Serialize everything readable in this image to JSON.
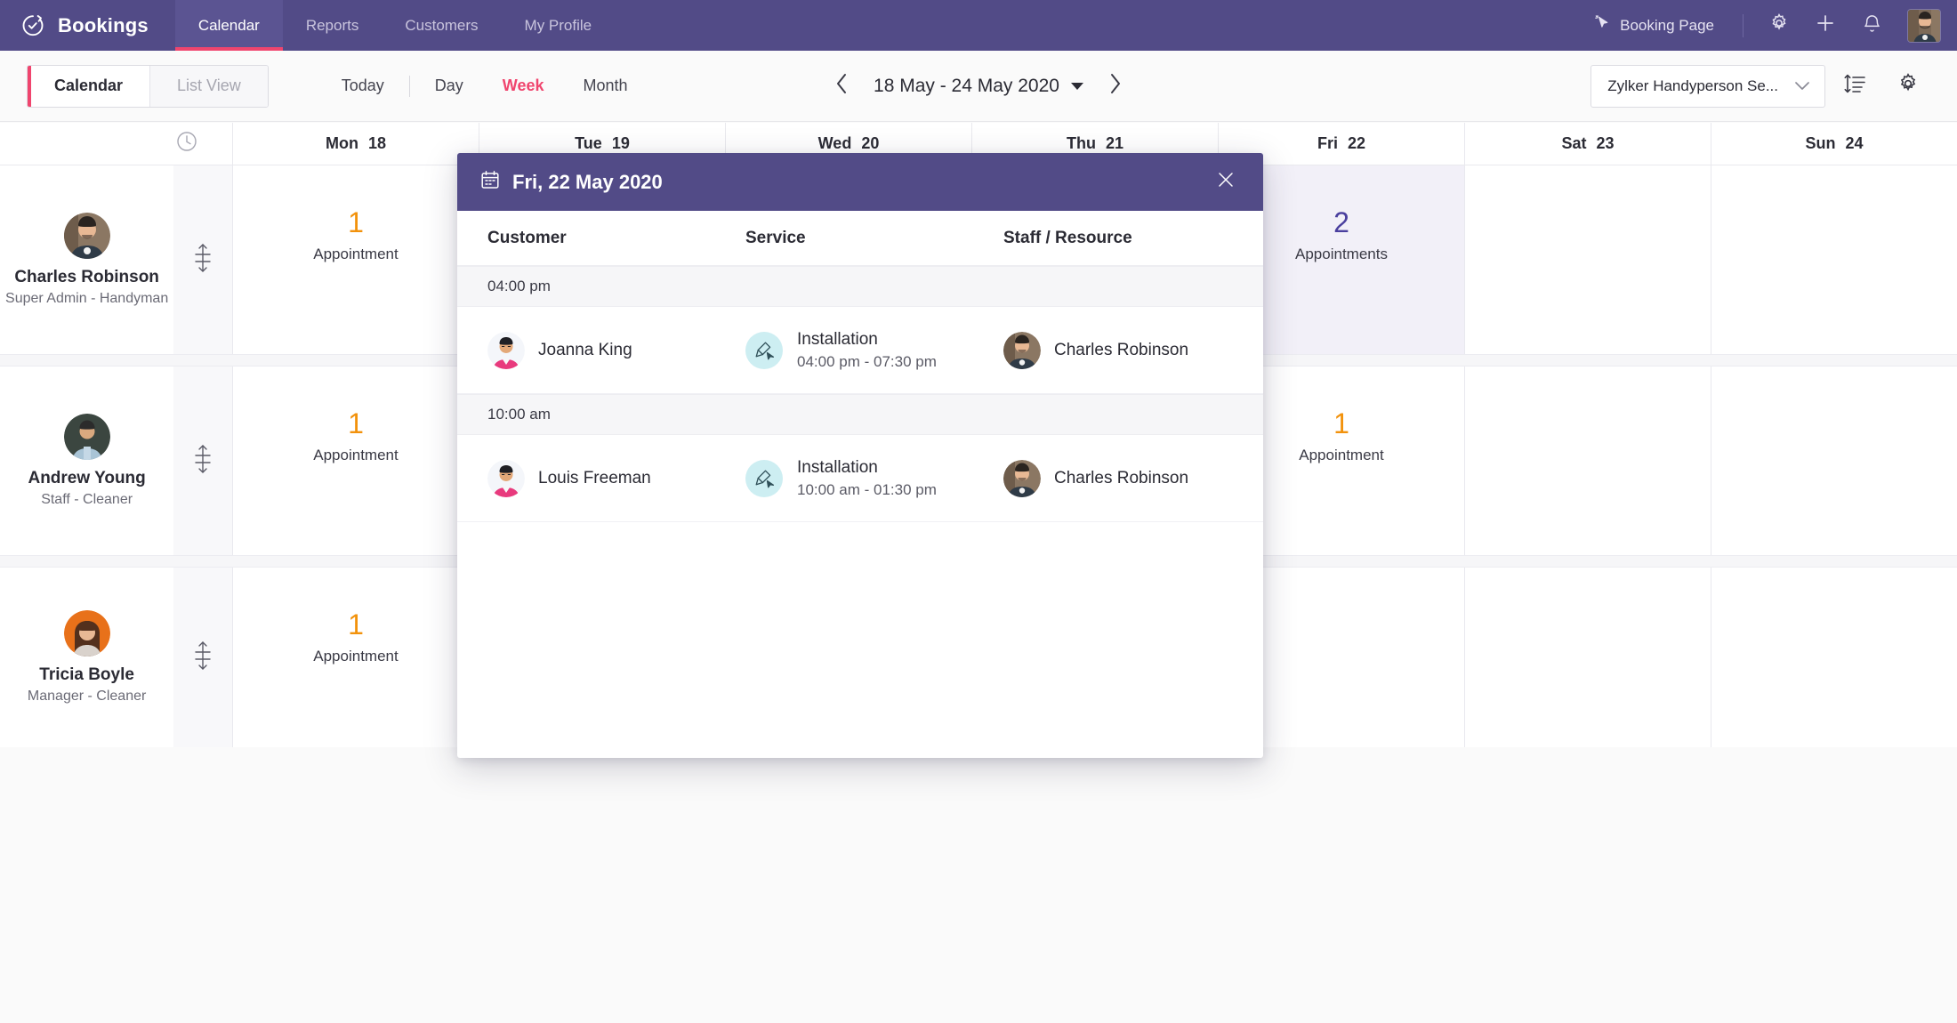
{
  "topnav": {
    "brand": "Bookings",
    "brand_icon": "bookings-logo-icon",
    "tabs": [
      {
        "label": "Calendar",
        "active": true
      },
      {
        "label": "Reports",
        "active": false
      },
      {
        "label": "Customers",
        "active": false
      },
      {
        "label": "My Profile",
        "active": false
      }
    ],
    "booking_page_label": "Booking Page",
    "booking_page_icon": "cursor-click-icon",
    "settings_icon": "gear-icon",
    "add_icon": "plus-icon",
    "notifications_icon": "bell-icon",
    "avatar_icon": "user-avatar",
    "bg_color": "#524b87",
    "active_underline_color": "#f0456e"
  },
  "toolbar": {
    "view_toggle": [
      {
        "label": "Calendar",
        "active": true
      },
      {
        "label": "List View",
        "active": false
      }
    ],
    "range_buttons": [
      {
        "label": "Today",
        "active": false
      },
      {
        "label": "Day",
        "active": false
      },
      {
        "label": "Week",
        "active": true
      },
      {
        "label": "Month",
        "active": false
      }
    ],
    "prev_icon": "chevron-left-icon",
    "next_icon": "chevron-right-icon",
    "date_range": "18 May - 24 May 2020",
    "resource_select_value": "Zylker Handyperson Se...",
    "resource_chevron_icon": "chevron-down-icon",
    "list_density_icon": "row-height-icon",
    "settings_icon": "gear-icon",
    "accent_color": "#f0456e"
  },
  "calendar": {
    "clock_icon": "clock-icon",
    "days": [
      {
        "name": "Mon",
        "num": "18"
      },
      {
        "name": "Tue",
        "num": "19"
      },
      {
        "name": "Wed",
        "num": "20"
      },
      {
        "name": "Thu",
        "num": "21"
      },
      {
        "name": "Fri",
        "num": "22"
      },
      {
        "name": "Sat",
        "num": "23"
      },
      {
        "name": "Sun",
        "num": "24"
      }
    ],
    "count_color": "#f2920c",
    "selected_count_color": "#4a3f9e",
    "rows": [
      {
        "name": "Charles Robinson",
        "role": "Super Admin - Handyman",
        "avatar": "charles-avatar",
        "resize_icon": "resize-vertical-icon",
        "cells": [
          {
            "count": "1",
            "label": "Appointment",
            "selected": false
          },
          {
            "count": "",
            "label": "",
            "selected": false
          },
          {
            "count": "",
            "label": "",
            "selected": false
          },
          {
            "count": "",
            "label": "",
            "selected": false
          },
          {
            "count": "2",
            "label": "Appointments",
            "selected": true
          },
          {
            "count": "",
            "label": "",
            "selected": false
          },
          {
            "count": "",
            "label": "",
            "selected": false
          }
        ]
      },
      {
        "name": "Andrew Young",
        "role": "Staff - Cleaner",
        "avatar": "andrew-avatar",
        "resize_icon": "resize-vertical-icon",
        "cells": [
          {
            "count": "1",
            "label": "Appointment",
            "selected": false
          },
          {
            "count": "",
            "label": "",
            "selected": false
          },
          {
            "count": "",
            "label": "",
            "selected": false
          },
          {
            "count": "",
            "label": "",
            "selected": false
          },
          {
            "count": "1",
            "label": "Appointment",
            "selected": false
          },
          {
            "count": "",
            "label": "",
            "selected": false
          },
          {
            "count": "",
            "label": "",
            "selected": false
          }
        ]
      },
      {
        "name": "Tricia Boyle",
        "role": "Manager - Cleaner",
        "avatar": "tricia-avatar",
        "resize_icon": "resize-vertical-icon",
        "cells": [
          {
            "count": "1",
            "label": "Appointment",
            "selected": false
          },
          {
            "count": "",
            "label": "",
            "selected": false
          },
          {
            "count": "",
            "label": "",
            "selected": false
          },
          {
            "count": "",
            "label": "",
            "selected": false
          },
          {
            "count": "",
            "label": "",
            "selected": false
          },
          {
            "count": "",
            "label": "",
            "selected": false
          },
          {
            "count": "",
            "label": "",
            "selected": false
          }
        ]
      }
    ]
  },
  "modal": {
    "title": "Fri, 22 May 2020",
    "calendar_icon": "calendar-icon",
    "close_icon": "close-icon",
    "header_bg": "#524b87",
    "columns": {
      "customer": "Customer",
      "service": "Service",
      "staff": "Staff / Resource"
    },
    "groups": [
      {
        "time": "04:00 pm",
        "appointments": [
          {
            "customer": "Joanna King",
            "customer_avatar": "joanna-avatar",
            "service": "Installation",
            "service_icon": "installation-icon",
            "service_time": "04:00 pm - 07:30 pm",
            "staff": "Charles Robinson",
            "staff_avatar": "charles-avatar"
          }
        ]
      },
      {
        "time": "10:00 am",
        "appointments": [
          {
            "customer": "Louis Freeman",
            "customer_avatar": "louis-avatar",
            "service": "Installation",
            "service_icon": "installation-icon",
            "service_time": "10:00 am - 01:30 pm",
            "staff": "Charles Robinson",
            "staff_avatar": "charles-avatar"
          }
        ]
      }
    ]
  }
}
